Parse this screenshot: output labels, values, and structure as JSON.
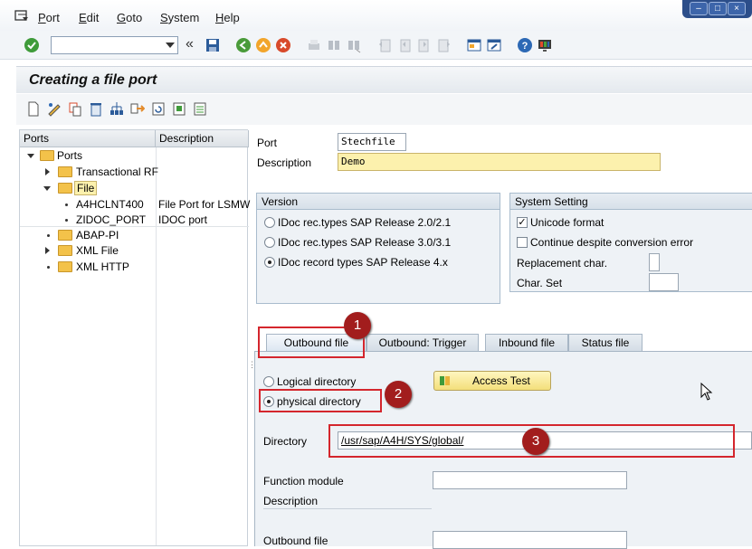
{
  "menubar": {
    "items": [
      {
        "label": "Port",
        "underline": "P"
      },
      {
        "label": "Edit",
        "underline": "E"
      },
      {
        "label": "Goto",
        "underline": "G"
      },
      {
        "label": "System",
        "underline": "S"
      },
      {
        "label": "Help",
        "underline": "H"
      }
    ],
    "window_controls": [
      "minimize-icon",
      "restore-icon",
      "close-icon"
    ]
  },
  "toolbar": {
    "command_field_value": "",
    "icons": [
      "enter-icon",
      "back-icon",
      "save-icon",
      "exit-icon",
      "cancel-icon",
      "print-icon",
      "find-icon",
      "find-next-icon",
      "first-page-icon",
      "previous-page-icon",
      "next-page-icon",
      "last-page-icon",
      "new-session-icon",
      "shortcut-icon",
      "help-icon",
      "layout-icon"
    ]
  },
  "header": {
    "title": "Creating a file port"
  },
  "app_toolbar": {
    "icons": [
      "create-icon",
      "change-icon",
      "copy-icon",
      "delete-icon",
      "hierarchy-icon",
      "move-icon",
      "refresh-icon",
      "select-icon",
      "details-icon"
    ]
  },
  "tree": {
    "columns": [
      "Ports",
      "Description"
    ],
    "rows": [
      {
        "label": "Ports",
        "description": "",
        "level": 0,
        "type": "folder-open",
        "expander": "down"
      },
      {
        "label": "Transactional RF",
        "description": "",
        "level": 1,
        "type": "folder",
        "expander": "right"
      },
      {
        "label": "File",
        "description": "",
        "level": 1,
        "type": "folder-open",
        "expander": "down",
        "selected": true
      },
      {
        "label": "A4HCLNT400",
        "description": "File Port for LSMW",
        "level": 2,
        "type": "leaf"
      },
      {
        "label": "ZIDOC_PORT",
        "description": "IDOC port",
        "level": 2,
        "type": "leaf"
      },
      {
        "label": "ABAP-PI",
        "description": "",
        "level": 1,
        "type": "folder",
        "expander": "bullet"
      },
      {
        "label": "XML File",
        "description": "",
        "level": 1,
        "type": "folder",
        "expander": "right"
      },
      {
        "label": "XML HTTP",
        "description": "",
        "level": 1,
        "type": "folder",
        "expander": "bullet"
      }
    ]
  },
  "form": {
    "port_label": "Port",
    "port_value": "Stechfile",
    "description_label": "Description",
    "description_value": "Demo",
    "version": {
      "title": "Version",
      "options": [
        {
          "label": "IDoc rec.types SAP Release 2.0/2.1",
          "selected": false
        },
        {
          "label": "IDoc rec.types SAP Release 3.0/3.1",
          "selected": false
        },
        {
          "label": "IDoc record types SAP Release 4.x",
          "selected": true
        }
      ]
    },
    "system_setting": {
      "title": "System Setting",
      "unicode_label": "Unicode format",
      "unicode_checked": true,
      "continue_label": "Continue despite conversion error",
      "continue_checked": false,
      "replacement_label": "Replacement char.",
      "replacement_value": "",
      "charset_label": "Char. Set",
      "charset_value": ""
    }
  },
  "tabs": [
    {
      "label": "Outbound file",
      "active": true
    },
    {
      "label": "Outbound: Trigger",
      "active": false
    },
    {
      "label": "Inbound file",
      "active": false
    },
    {
      "label": "Status file",
      "active": false
    }
  ],
  "outbound": {
    "logical_label": "Logical directory",
    "physical_label": "physical directory",
    "physical_selected": true,
    "access_test_label": "Access Test",
    "directory_label": "Directory",
    "directory_value": "/usr/sap/A4H/SYS/global/",
    "function_module_label": "Function module",
    "function_module_value": "",
    "description_label": "Description",
    "outbound_file_label": "Outbound file",
    "outbound_file_value": ""
  },
  "annotations": {
    "markers": [
      "1",
      "2",
      "3"
    ]
  }
}
